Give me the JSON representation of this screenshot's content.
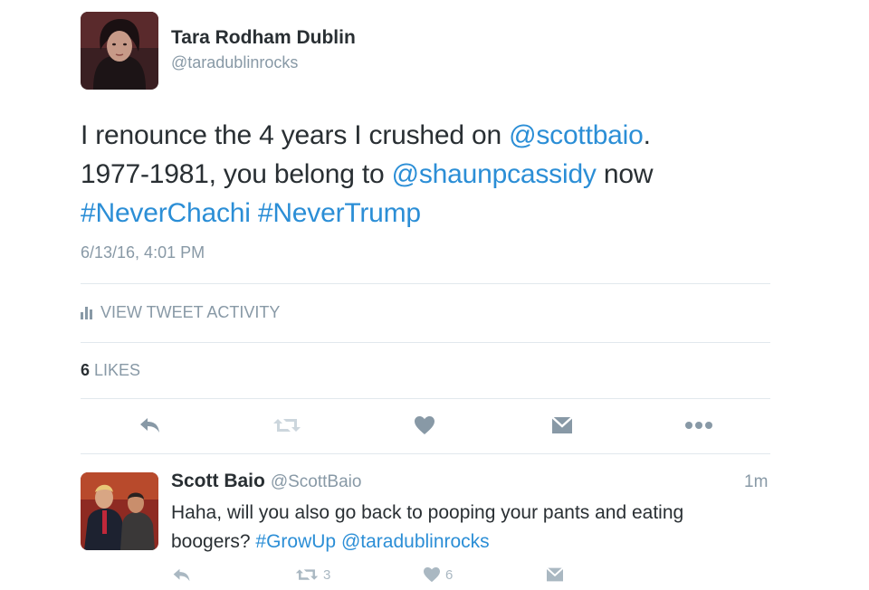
{
  "tweet": {
    "author_name": "Tara Rodham Dublin",
    "author_handle": "@taradublinrocks",
    "text_line1_prefix": "I renounce the 4 years I crushed on ",
    "text_line1_mention": "@scottbaio",
    "text_line1_suffix": ".",
    "text_line2_prefix": "1977-1981, you belong to ",
    "text_line2_mention": "@shaunpcassidy",
    "text_line2_suffix": " now",
    "hashtag1": "#NeverChachi",
    "hashtag2": "#NeverTrump",
    "timestamp": "6/13/16, 4:01 PM",
    "activity_label": "VIEW TWEET ACTIVITY",
    "likes_count": "6",
    "likes_label": "LIKES"
  },
  "actions": [
    "reply-icon",
    "retweet-icon",
    "heart-icon",
    "message-icon",
    "more-icon"
  ],
  "reply": {
    "author_name": "Scott Baio",
    "author_handle": "@ScottBaio",
    "time": "1m",
    "text_prefix": "Haha, will you also go back to pooping your pants and eating boogers? ",
    "hashtag": "#GrowUp",
    "mention": "@taradublinrocks",
    "retweet_count": "3",
    "like_count": "6"
  },
  "colors": {
    "link": "#2b8ed6",
    "icon": "#aab8c2",
    "muted": "#8899a6",
    "text": "#292f33"
  }
}
